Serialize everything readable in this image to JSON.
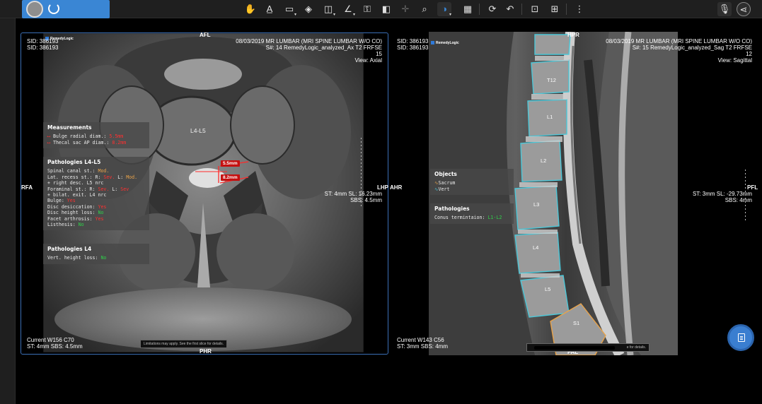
{
  "toolbar": {
    "icons": [
      "pan-icon",
      "annotate-icon",
      "rectangle-icon",
      "layers-icon",
      "split-icon",
      "angle-icon",
      "key-icon",
      "invert-icon",
      "crosshair-icon",
      "zoom-icon",
      "contrast-icon",
      "layout-icon",
      "rotate-icon",
      "undo-icon",
      "screenshot-icon",
      "export-icon",
      "more-icon",
      "mic-icon",
      "share-icon"
    ]
  },
  "left_pane": {
    "logo": "RemedyLogic",
    "sid1": "SID: 386193",
    "sid2": "SID: 386193",
    "study": "08/03/2019  MR LUMBAR (MRI SPINE LUMBAR W/O CO)",
    "series": "S#: 14  RemedyLogic_analyzed_Ax T2 FRFSE",
    "image_num": "15",
    "view": "View: Axial",
    "orient_top": "AFL",
    "orient_bottom": "PHR",
    "orient_left": "RFA",
    "orient_right": "LHP",
    "st_sl": "ST: 4mm  SL: 16.23mm",
    "sbs": "SBS: 4.5mm",
    "wl": "Current  W156 C70",
    "st_sbs": "ST: 4mm  SBS: 4.5mm",
    "disc_label": "L4-L5",
    "meas1": "5.5mm",
    "meas2": "8.2mm",
    "footnote": "Limitations may apply. See the first slice for details.",
    "measurements": {
      "title": "Measurements",
      "row1_label": "Bulge radial diam.: ",
      "row1_val": "5.5mm",
      "row2_label": "Thecal sac AP diam.: ",
      "row2_val": "8.2mm"
    },
    "path1": {
      "title": "Pathologies L4-L5",
      "spinal_canal_label": "Spinal canal st.: ",
      "spinal_canal_val": "Mod.",
      "lat_recess_label": "Lat. recess st.: R: ",
      "lat_recess_r": "Sev.",
      "lat_recess_l_label": "  L: ",
      "lat_recess_l": "Mod.",
      "lat_recess_note": "  + right desc. L5 nrc",
      "foraminal_label": "Foraminal st.: R: ",
      "foraminal_r": "Sev.",
      "foraminal_l_label": "  L: ",
      "foraminal_l": "Sev",
      "foraminal_note": "  + bilat. exit. L4 nrc",
      "bulge_label": "Bulge: ",
      "bulge_val": "Yes",
      "desiccation_label": "Disc desiccation: ",
      "desiccation_val": "Yes",
      "height_label": "Disc height loss: ",
      "height_val": "No",
      "facet_label": "Facet arthrosis: ",
      "facet_val": "Yes",
      "listhesis_label": "Listhesis: ",
      "listhesis_val": "No"
    },
    "path2": {
      "title": "Pathologies L4",
      "vert_label": "Vert. height loss: ",
      "vert_val": "No"
    }
  },
  "right_pane": {
    "logo": "RemedyLogic",
    "sid1": "SID: 386193",
    "sid2": "SID: 386193",
    "study": "08/03/2019  MR LUMBAR (MRI SPINE LUMBAR W/O CO)",
    "series": "S#: 15  RemedyLogic_analyzed_Sag T2 FRFSE",
    "image_num": "12",
    "view": "View: Sagittal",
    "orient_top": "HPR",
    "orient_bottom": "FAL",
    "orient_left": "AHR",
    "orient_right": "PFL",
    "st_sl": "ST: 3mm  SL: -29.73mm",
    "sbs": "SBS: 4mm",
    "wl": "Current  W143 C56",
    "st_sbs": "ST: 3mm  SBS: 4mm",
    "footnote_tail": "e for details.",
    "vertebrae": [
      "T12",
      "L1",
      "L2",
      "L3",
      "L4",
      "L5",
      "S1"
    ],
    "objects": {
      "title": "Objects",
      "item1": "Sacrum",
      "item2": "Vert"
    },
    "path": {
      "title": "Pathologies",
      "conus_label": "Conus termintaion: ",
      "conus_val": "L1-L2"
    }
  },
  "colors": {
    "accent": "#3a86d4",
    "severe": "#ff3030",
    "normal": "#2fd14a",
    "sacrum": "#e8a34a",
    "vert": "#4cc7d8"
  }
}
